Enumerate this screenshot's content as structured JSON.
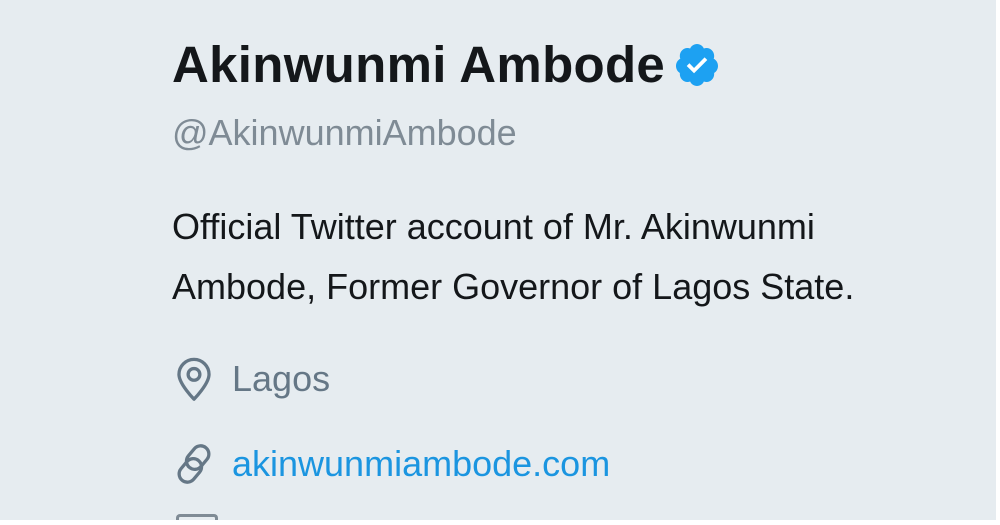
{
  "profile": {
    "display_name": "Akinwunmi Ambode",
    "verified": true,
    "handle": "@AkinwunmiAmbode",
    "bio_lines": [
      "Official Twitter account of Mr. Akinwunmi",
      "Ambode, Former Governor of Lagos State."
    ],
    "location": "Lagos",
    "website": "akinwunmiambode.com"
  },
  "icons": {
    "verified": "verified-badge-icon",
    "location": "location-pin-icon",
    "website": "link-icon",
    "joined": "calendar-icon"
  },
  "colors": {
    "background": "#e6ecf0",
    "name": "#14171a",
    "muted": "#657786",
    "link": "#1b95e0",
    "verified": "#1da1f2"
  }
}
